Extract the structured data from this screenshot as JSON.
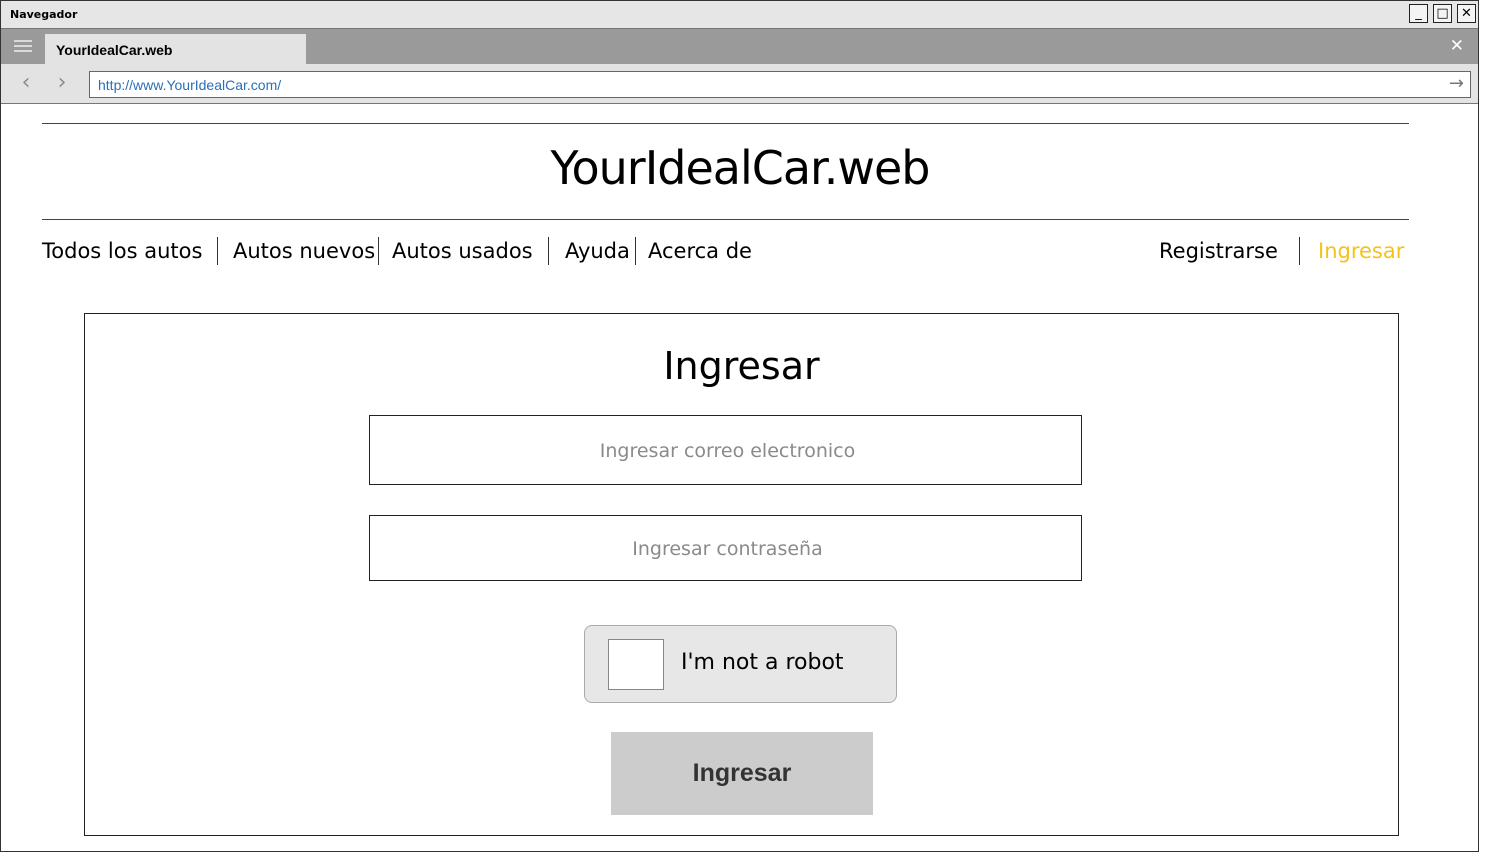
{
  "window": {
    "title": "Navegador",
    "controls": {
      "minimize": "_",
      "maximize": "□",
      "close": "✕"
    }
  },
  "browser": {
    "tab_label": "YourIdealCar.web",
    "tab_close": "✕",
    "back": "‹",
    "forward": "›",
    "url": "http://www.YourIdealCar.com/",
    "go": "→"
  },
  "site": {
    "title": "YourIdealCar.web",
    "nav": [
      "Todos los autos",
      "Autos nuevos",
      "Autos usados",
      "Ayuda",
      "Acerca de"
    ],
    "account": {
      "register": "Registrarse",
      "login": "Ingresar"
    },
    "accent_color": "#f5c21b"
  },
  "login": {
    "title": "Ingresar",
    "email_placeholder": "Ingresar correo electronico",
    "password_placeholder": "Ingresar contraseña",
    "captcha_label": "I'm not a robot",
    "submit_label": "Ingresar"
  }
}
